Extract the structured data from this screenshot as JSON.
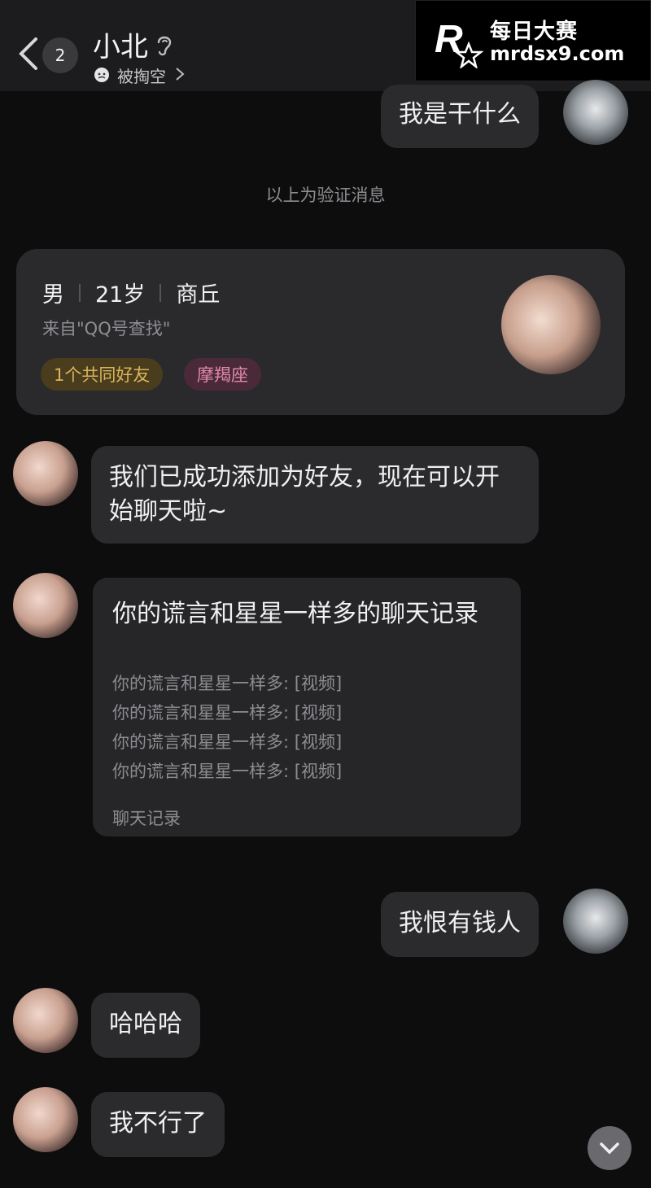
{
  "header": {
    "unread_count": "2",
    "contact_name": "小北",
    "status_text": "被掏空"
  },
  "watermark": {
    "title": "每日大赛",
    "url": "mrdsx9.com"
  },
  "messages": {
    "m1": "我是干什么",
    "system_note": "以上为验证消息",
    "m2": "我们已成功添加为好友，现在可以开始聊天啦~",
    "m3": "我恨有钱人",
    "m4": "哈哈哈",
    "m5": "我不行了"
  },
  "profile_card": {
    "gender": "男",
    "age": "21岁",
    "location": "商丘",
    "source": "来自\"QQ号查找\"",
    "tag_mutual": "1个共同好友",
    "tag_zodiac": "摩羯座"
  },
  "chat_record": {
    "title": "你的谎言和星星一样多的聊天记录",
    "lines": [
      "你的谎言和星星一样多: [视频]",
      "你的谎言和星星一样多: [视频]",
      "你的谎言和星星一样多: [视频]",
      "你的谎言和星星一样多: [视频]"
    ],
    "footer": "聊天记录"
  },
  "colors": {
    "background": "#0d0d0e",
    "bubble": "#2b2b2e",
    "tag_mutual": "#d9b45a",
    "tag_zodiac": "#e08aa8"
  }
}
